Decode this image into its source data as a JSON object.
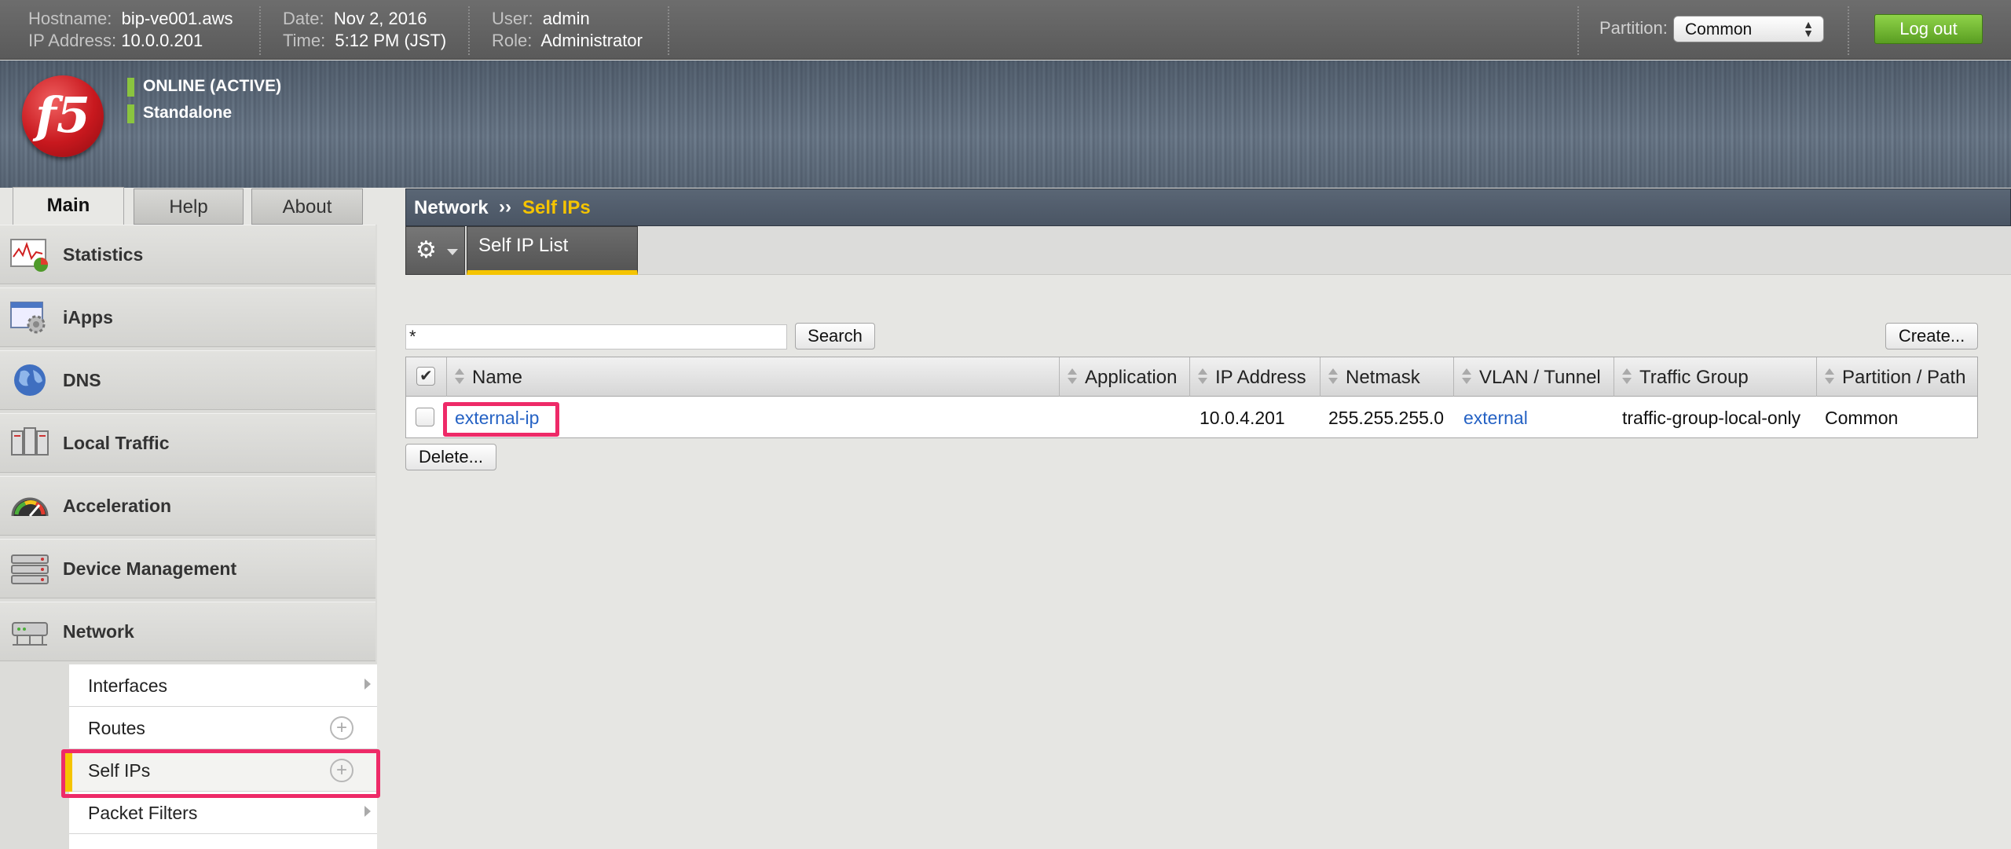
{
  "topbar": {
    "hostname_label": "Hostname:",
    "hostname": "bip-ve001.aws",
    "ip_label": "IP Address:",
    "ip": "10.0.0.201",
    "date_label": "Date:",
    "date": "Nov 2, 2016",
    "time_label": "Time:",
    "time": "5:12 PM (JST)",
    "user_label": "User:",
    "user": "admin",
    "role_label": "Role:",
    "role": "Administrator",
    "partition_label": "Partition:",
    "partition_value": "Common",
    "logout_label": "Log out"
  },
  "banner": {
    "logo_text": "f5",
    "status_online": "ONLINE (ACTIVE)",
    "status_mode": "Standalone"
  },
  "tabs": [
    {
      "label": "Main",
      "active": true
    },
    {
      "label": "Help",
      "active": false
    },
    {
      "label": "About",
      "active": false
    }
  ],
  "sidebar": {
    "items": [
      {
        "label": "Statistics",
        "icon": "statistics-icon"
      },
      {
        "label": "iApps",
        "icon": "iapps-icon"
      },
      {
        "label": "DNS",
        "icon": "dns-globe-icon"
      },
      {
        "label": "Local Traffic",
        "icon": "local-traffic-icon"
      },
      {
        "label": "Acceleration",
        "icon": "acceleration-gauge-icon"
      },
      {
        "label": "Device Management",
        "icon": "device-management-icon"
      },
      {
        "label": "Network",
        "icon": "network-icon"
      }
    ],
    "network_submenu": [
      {
        "label": "Interfaces",
        "control": "arrow"
      },
      {
        "label": "Routes",
        "control": "plus"
      },
      {
        "label": "Self IPs",
        "control": "plus",
        "active": true
      },
      {
        "label": "Packet Filters",
        "control": "arrow"
      }
    ]
  },
  "breadcrumb": {
    "section": "Network",
    "separator": "››",
    "page": "Self IPs"
  },
  "subtabs": {
    "gear_icon": "gear-icon",
    "active_label": "Self IP List"
  },
  "search": {
    "value": "*",
    "button": "Search"
  },
  "create_button": "Create...",
  "delete_button": "Delete...",
  "table": {
    "columns": [
      "Name",
      "Application",
      "IP Address",
      "Netmask",
      "VLAN / Tunnel",
      "Traffic Group",
      "Partition / Path"
    ],
    "rows": [
      {
        "name": "external-ip",
        "application": "",
        "ip_address": "10.0.4.201",
        "netmask": "255.255.255.0",
        "vlan": "external",
        "traffic_group": "traffic-group-local-only",
        "partition": "Common"
      }
    ]
  },
  "colors": {
    "accent_yellow": "#f5c400",
    "logout_green": "#6cb52d",
    "highlight_pink": "#ee2a68",
    "link_blue": "#2562c4",
    "status_green": "#8ac43f"
  }
}
